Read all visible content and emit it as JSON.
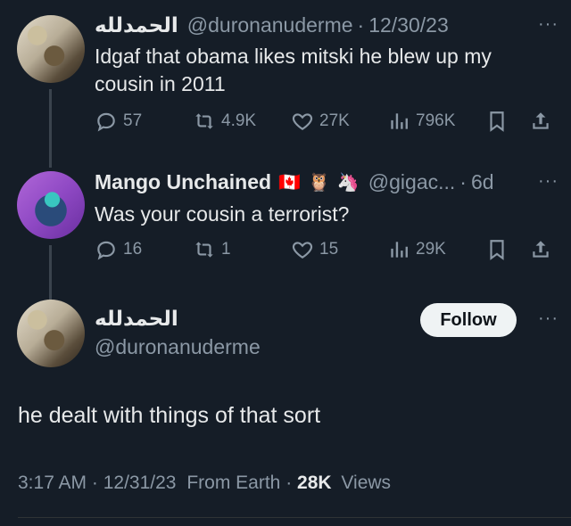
{
  "tweet1": {
    "display_name": "الحمدلله",
    "handle": "@duronanuderme",
    "date": "12/30/23",
    "more": "···",
    "text_line1": "Idgaf that obama likes mitski he blew up my",
    "text_line2": "cousin in 2011",
    "replies": "57",
    "retweets": "4.9K",
    "likes": "27K",
    "views": "796K"
  },
  "tweet2": {
    "display_name": "Mango Unchained",
    "flag": "🇨🇦",
    "emoji1": "🦉",
    "emoji2": "🦄",
    "handle": "@gigac...",
    "date": "6d",
    "more": "···",
    "text": "Was your cousin a terrorist?",
    "replies": "16",
    "retweets": "1",
    "likes": "15",
    "views": "29K"
  },
  "main_tweet": {
    "display_name": "الحمدلله",
    "handle": "@duronanuderme",
    "follow_label": "Follow",
    "more": "···",
    "text": "he dealt with things of that sort",
    "time": "3:17 AM",
    "date": "12/31/23",
    "source": "From Earth",
    "views_count": "28K",
    "views_label": "Views"
  },
  "colors": {
    "background": "#151d27",
    "text_primary": "#e7e9ea",
    "text_secondary": "#8b98a5",
    "follow_bg": "#eff3f4"
  }
}
